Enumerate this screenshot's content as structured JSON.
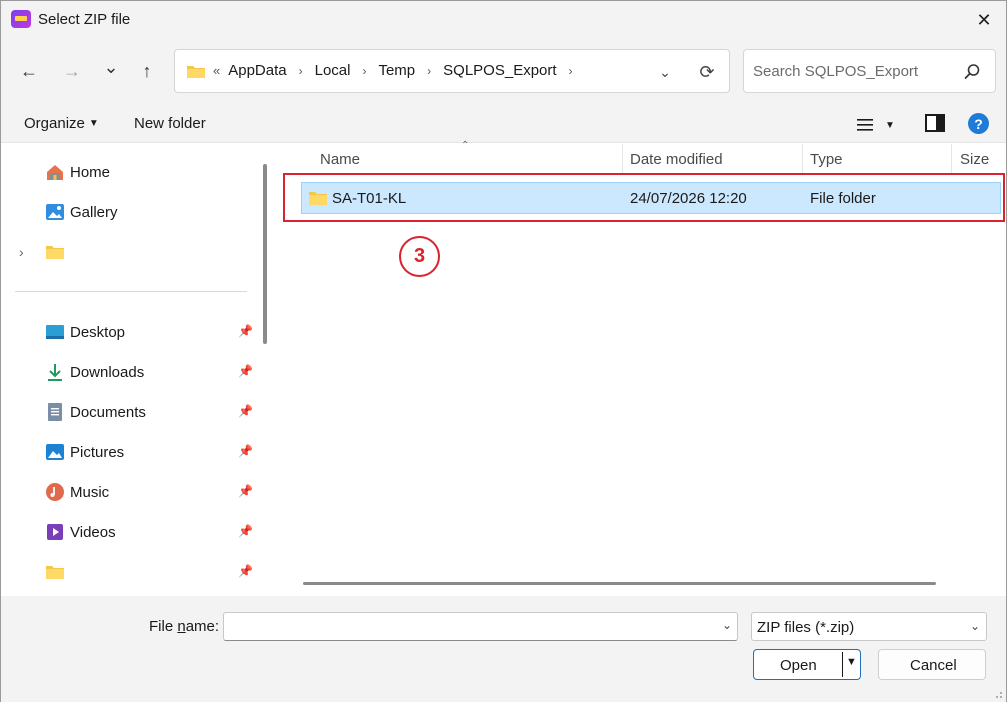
{
  "window": {
    "title": "Select ZIP file",
    "close": "✕"
  },
  "nav": {
    "back": "←",
    "forward": "→",
    "recent": "⌄",
    "up": "↑",
    "breadcrumb_lead": "«",
    "crumbs": [
      "AppData",
      "Local",
      "Temp",
      "SQLPOS_Export"
    ],
    "crumb_sep": "›",
    "search_placeholder": "Search SQLPOS_Export"
  },
  "commands": {
    "organize": "Organize",
    "new_folder": "New folder",
    "help": "?"
  },
  "sidebar": {
    "items": [
      {
        "label": "Home",
        "icon": "home-icon"
      },
      {
        "label": "Gallery",
        "icon": "gallery-icon"
      },
      {
        "label": "",
        "icon": "folder-icon"
      },
      {
        "label": "Desktop",
        "icon": "desktop-icon"
      },
      {
        "label": "Downloads",
        "icon": "downloads-icon"
      },
      {
        "label": "Documents",
        "icon": "documents-icon"
      },
      {
        "label": "Pictures",
        "icon": "pictures-icon"
      },
      {
        "label": "Music",
        "icon": "music-icon"
      },
      {
        "label": "Videos",
        "icon": "videos-icon"
      },
      {
        "label": "",
        "icon": "folder-icon"
      }
    ]
  },
  "columns": {
    "name": "Name",
    "date": "Date modified",
    "type": "Type",
    "size": "Size"
  },
  "files": [
    {
      "name": "SA-T01-KL",
      "date": "24/07/2026 12:20",
      "type": "File folder",
      "selected": true
    }
  ],
  "annotation": {
    "step": "3",
    "color": "#d9232e"
  },
  "bottom": {
    "file_name_label_pre": "File ",
    "file_name_label_u": "n",
    "file_name_label_post": "ame:",
    "file_name_value": "",
    "file_type": "ZIP files (*.zip)",
    "open": "Open",
    "cancel": "Cancel"
  },
  "colors": {
    "selection_bg": "#cce8ff",
    "accent": "#1f6fbf",
    "chrome_bg": "#f3f3f3"
  }
}
